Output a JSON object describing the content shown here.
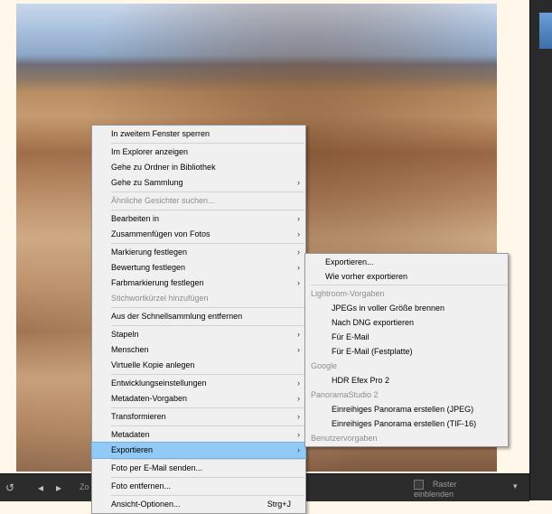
{
  "context_menu": {
    "items": [
      {
        "label": "In zweitem Fenster sperren",
        "submenu": false,
        "disabled": false
      },
      {
        "sep": true
      },
      {
        "label": "Im Explorer anzeigen",
        "submenu": false,
        "disabled": false
      },
      {
        "label": "Gehe zu Ordner in Bibliothek",
        "submenu": false,
        "disabled": false
      },
      {
        "label": "Gehe zu Sammlung",
        "submenu": true,
        "disabled": false
      },
      {
        "sep": true
      },
      {
        "label": "Ähnliche Gesichter suchen...",
        "submenu": false,
        "disabled": true
      },
      {
        "sep": true
      },
      {
        "label": "Bearbeiten in",
        "submenu": true,
        "disabled": false
      },
      {
        "label": "Zusammenfügen von Fotos",
        "submenu": true,
        "disabled": false
      },
      {
        "sep": true
      },
      {
        "label": "Markierung festlegen",
        "submenu": true,
        "disabled": false
      },
      {
        "label": "Bewertung festlegen",
        "submenu": true,
        "disabled": false
      },
      {
        "label": "Farbmarkierung festlegen",
        "submenu": true,
        "disabled": false
      },
      {
        "label": "Stichwortkürzel hinzufügen",
        "submenu": false,
        "disabled": true
      },
      {
        "sep": true
      },
      {
        "label": "Aus der Schnellsammlung entfernen",
        "submenu": false,
        "disabled": false
      },
      {
        "sep": true
      },
      {
        "label": "Stapeln",
        "submenu": true,
        "disabled": false
      },
      {
        "label": "Menschen",
        "submenu": true,
        "disabled": false
      },
      {
        "label": "Virtuelle Kopie anlegen",
        "submenu": false,
        "disabled": false
      },
      {
        "sep": true
      },
      {
        "label": "Entwicklungseinstellungen",
        "submenu": true,
        "disabled": false
      },
      {
        "label": "Metadaten-Vorgaben",
        "submenu": true,
        "disabled": false
      },
      {
        "sep": true
      },
      {
        "label": "Transformieren",
        "submenu": true,
        "disabled": false
      },
      {
        "sep": true
      },
      {
        "label": "Metadaten",
        "submenu": true,
        "disabled": false
      },
      {
        "label": "Exportieren",
        "submenu": true,
        "disabled": false,
        "highlighted": true
      },
      {
        "sep": true
      },
      {
        "label": "Foto per E-Mail senden...",
        "submenu": false,
        "disabled": false
      },
      {
        "sep": true
      },
      {
        "label": "Foto entfernen...",
        "submenu": false,
        "disabled": false
      },
      {
        "sep": true
      },
      {
        "label": "Ansicht-Optionen...",
        "submenu": false,
        "disabled": false,
        "shortcut": "Strg+J"
      }
    ]
  },
  "export_submenu": {
    "items": [
      {
        "label": "Exportieren...",
        "type": "item"
      },
      {
        "label": "Wie vorher exportieren",
        "type": "item"
      },
      {
        "type": "sep"
      },
      {
        "label": "Lightroom-Vorgaben",
        "type": "header"
      },
      {
        "label": "JPEGs in voller Größe brennen",
        "type": "item"
      },
      {
        "label": "Nach DNG exportieren",
        "type": "item"
      },
      {
        "label": "Für E-Mail",
        "type": "item"
      },
      {
        "label": "Für E-Mail (Festplatte)",
        "type": "item"
      },
      {
        "label": "Google",
        "type": "header"
      },
      {
        "label": "HDR Efex Pro 2",
        "type": "item"
      },
      {
        "label": "PanoramaStudio 2",
        "type": "header"
      },
      {
        "label": "Einreihiges Panorama erstellen (JPEG)",
        "type": "item"
      },
      {
        "label": "Einreihiges Panorama erstellen (TIF-16)",
        "type": "item"
      },
      {
        "label": "Benutzervorgaben",
        "type": "header"
      }
    ]
  },
  "toolbar": {
    "grid_label": "Raster einblenden",
    "zoom_label": "Zo"
  },
  "colors": {
    "menu_bg": "#f0f0f0",
    "highlight": "#91c9f7",
    "panel_bg": "#2a2a2a"
  }
}
